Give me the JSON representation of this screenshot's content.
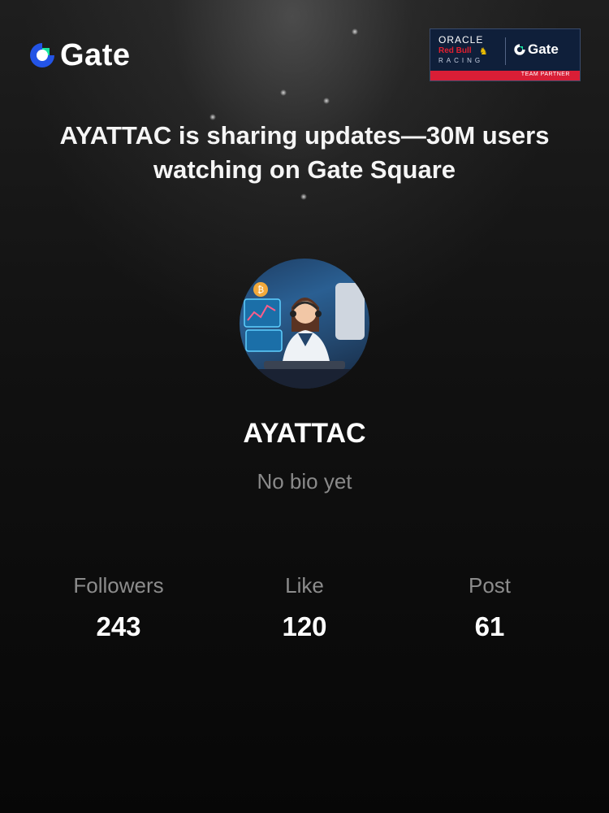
{
  "brand": {
    "name": "Gate",
    "accent": "#2354e6",
    "accent_green": "#17e6a1"
  },
  "partner_badge": {
    "oracle": "ORACLE",
    "redbull": "Red Bull",
    "racing": "RACING",
    "gate": "Gate",
    "strip": "TEAM PARTNER",
    "strip_color": "#d91e36"
  },
  "headline": "AYATTAC is sharing updates—30M users watching on Gate Square",
  "profile": {
    "avatar_icon": "avatar-icon",
    "username": "AYATTAC",
    "bio": "No bio yet"
  },
  "stats": [
    {
      "label": "Followers",
      "value": "243"
    },
    {
      "label": "Like",
      "value": "120"
    },
    {
      "label": "Post",
      "value": "61"
    }
  ]
}
